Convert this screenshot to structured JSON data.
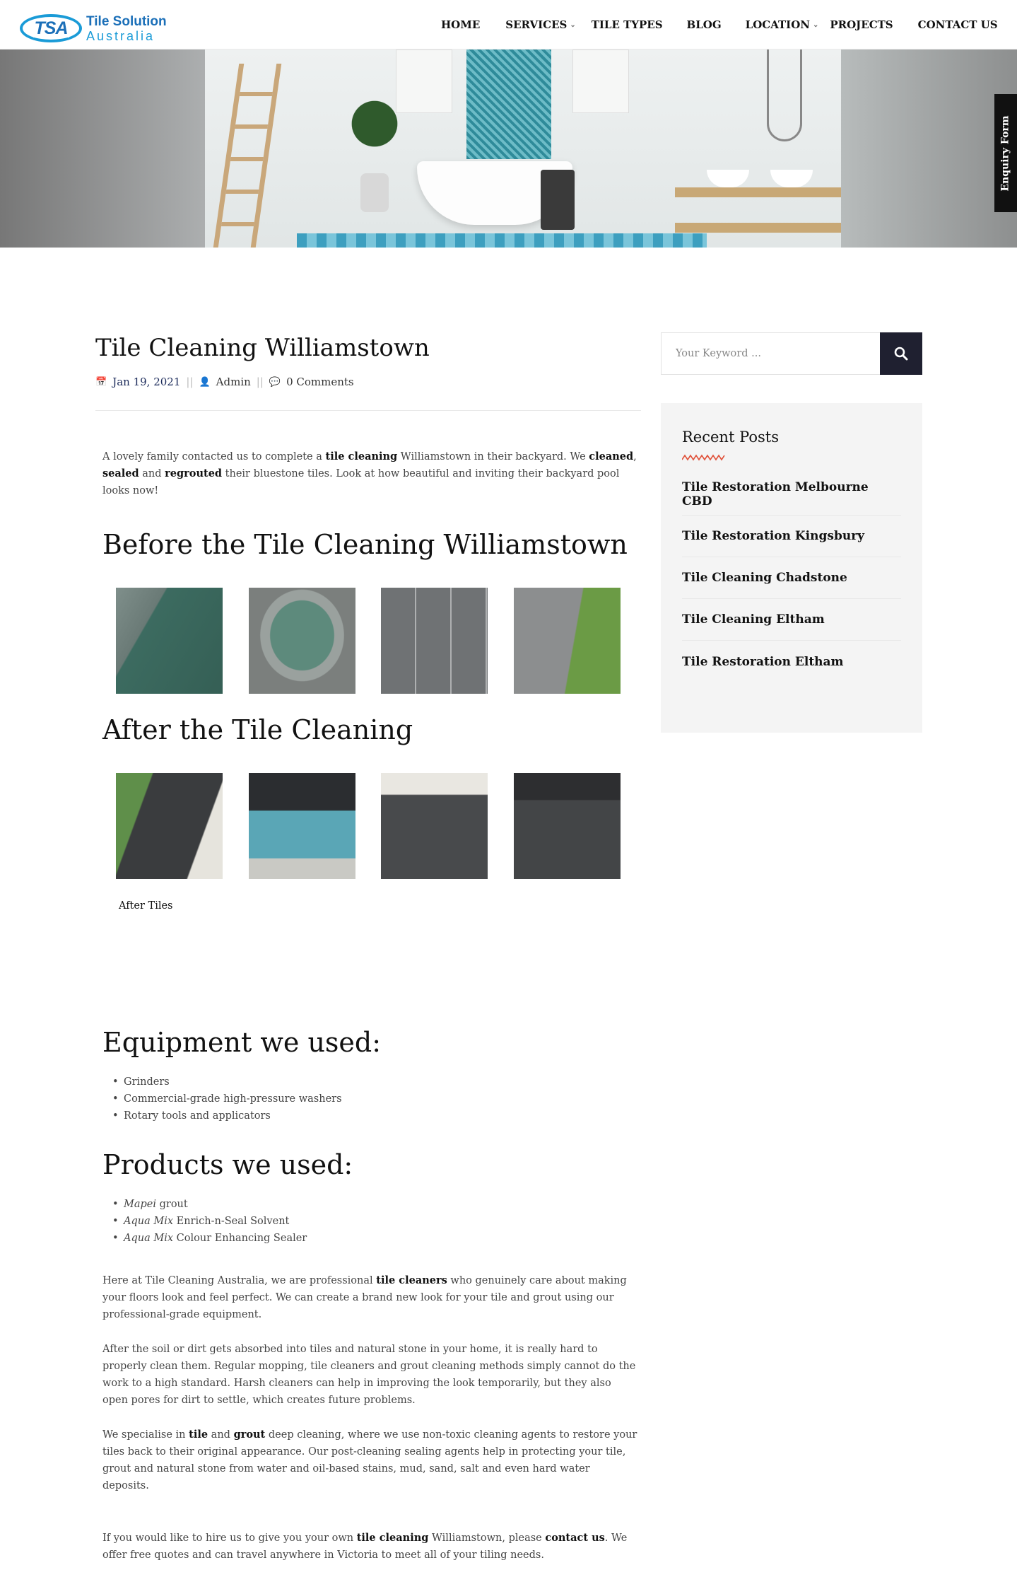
{
  "header": {
    "logo_mark": "TSA",
    "logo_line1": "Tile Solution",
    "logo_line2": "Australia",
    "nav": [
      {
        "label": "HOME"
      },
      {
        "label": "SERVICES"
      },
      {
        "label": "TILE TYPES"
      },
      {
        "label": "BLOG"
      },
      {
        "label": "LOCATION"
      },
      {
        "label": "PROJECTS"
      },
      {
        "label": "CONTACT US"
      }
    ]
  },
  "enquiry_tab": "Enquiry Form",
  "post": {
    "title": "Tile Cleaning Williamstown",
    "date": "Jan 19, 2021",
    "author": "Admin",
    "comments": "0 Comments",
    "intro": {
      "t1": "A lovely family contacted us to complete a ",
      "b1": "tile cleaning",
      "t2": " Williamstown in their backyard. We ",
      "b2": "cleaned",
      "t3": ", ",
      "b3": "sealed",
      "t4": " and ",
      "b4": "regrouted",
      "t5": " their bluestone tiles. Look at how beautiful and inviting their backyard pool looks now!"
    },
    "before_heading": "Before the Tile Cleaning Williamstown",
    "after_heading": "After the Tile Cleaning",
    "after_caption": "After Tiles",
    "equipment_heading": "Equipment we used:",
    "equipment": [
      "Grinders",
      "Commercial-grade high-pressure washers",
      "Rotary tools and applicators"
    ],
    "products_heading": "Products we used:",
    "products": [
      {
        "brand": "Mapei",
        "rest": " grout"
      },
      {
        "brand": "Aqua Mix",
        "rest": " Enrich-n-Seal Solvent"
      },
      {
        "brand": "Aqua Mix",
        "rest": " Colour Enhancing Sealer"
      }
    ],
    "para1": {
      "t1": "Here at Tile Cleaning Australia, we are professional ",
      "b1": "tile cleaners",
      "t2": " who genuinely care about making your floors look and feel perfect. We can create a brand new look for your tile and grout using our professional-grade equipment."
    },
    "para2": "After the soil or dirt gets absorbed into tiles and natural stone in your home, it is really hard to properly clean them. Regular mopping, tile cleaners and grout cleaning methods simply cannot do the work to a high standard. Harsh cleaners can help in improving the look temporarily, but they also open pores for dirt to settle, which creates future problems.",
    "para3": {
      "t1": "We specialise in ",
      "b1": "tile",
      "t2": " and ",
      "b2": "grout",
      "t3": " deep cleaning, where we use non-toxic cleaning agents to restore your tiles back to their original appearance. Our post-cleaning sealing agents help in protecting your tile, grout and natural stone from water and oil-based stains, mud, sand, salt and even hard water deposits."
    },
    "para4": {
      "t1": "If you would like to hire us to give you your own ",
      "b1": "tile cleaning",
      "t2": " Williamstown, please ",
      "b2": "contact us",
      "t3": ". We offer free quotes and can travel anywhere in Victoria to meet all of your tiling needs."
    }
  },
  "sidebar": {
    "search_placeholder": "Your Keyword ...",
    "recent_title": "Recent Posts",
    "recent_posts": [
      "Tile Restoration Melbourne CBD",
      "Tile Restoration Kingsbury",
      "Tile Cleaning Chadstone",
      "Tile Cleaning Eltham",
      "Tile Restoration Eltham"
    ]
  },
  "colors": {
    "accent": "#e0523b",
    "brand_blue": "#1b6fb8",
    "search_button": "#1f2030"
  }
}
